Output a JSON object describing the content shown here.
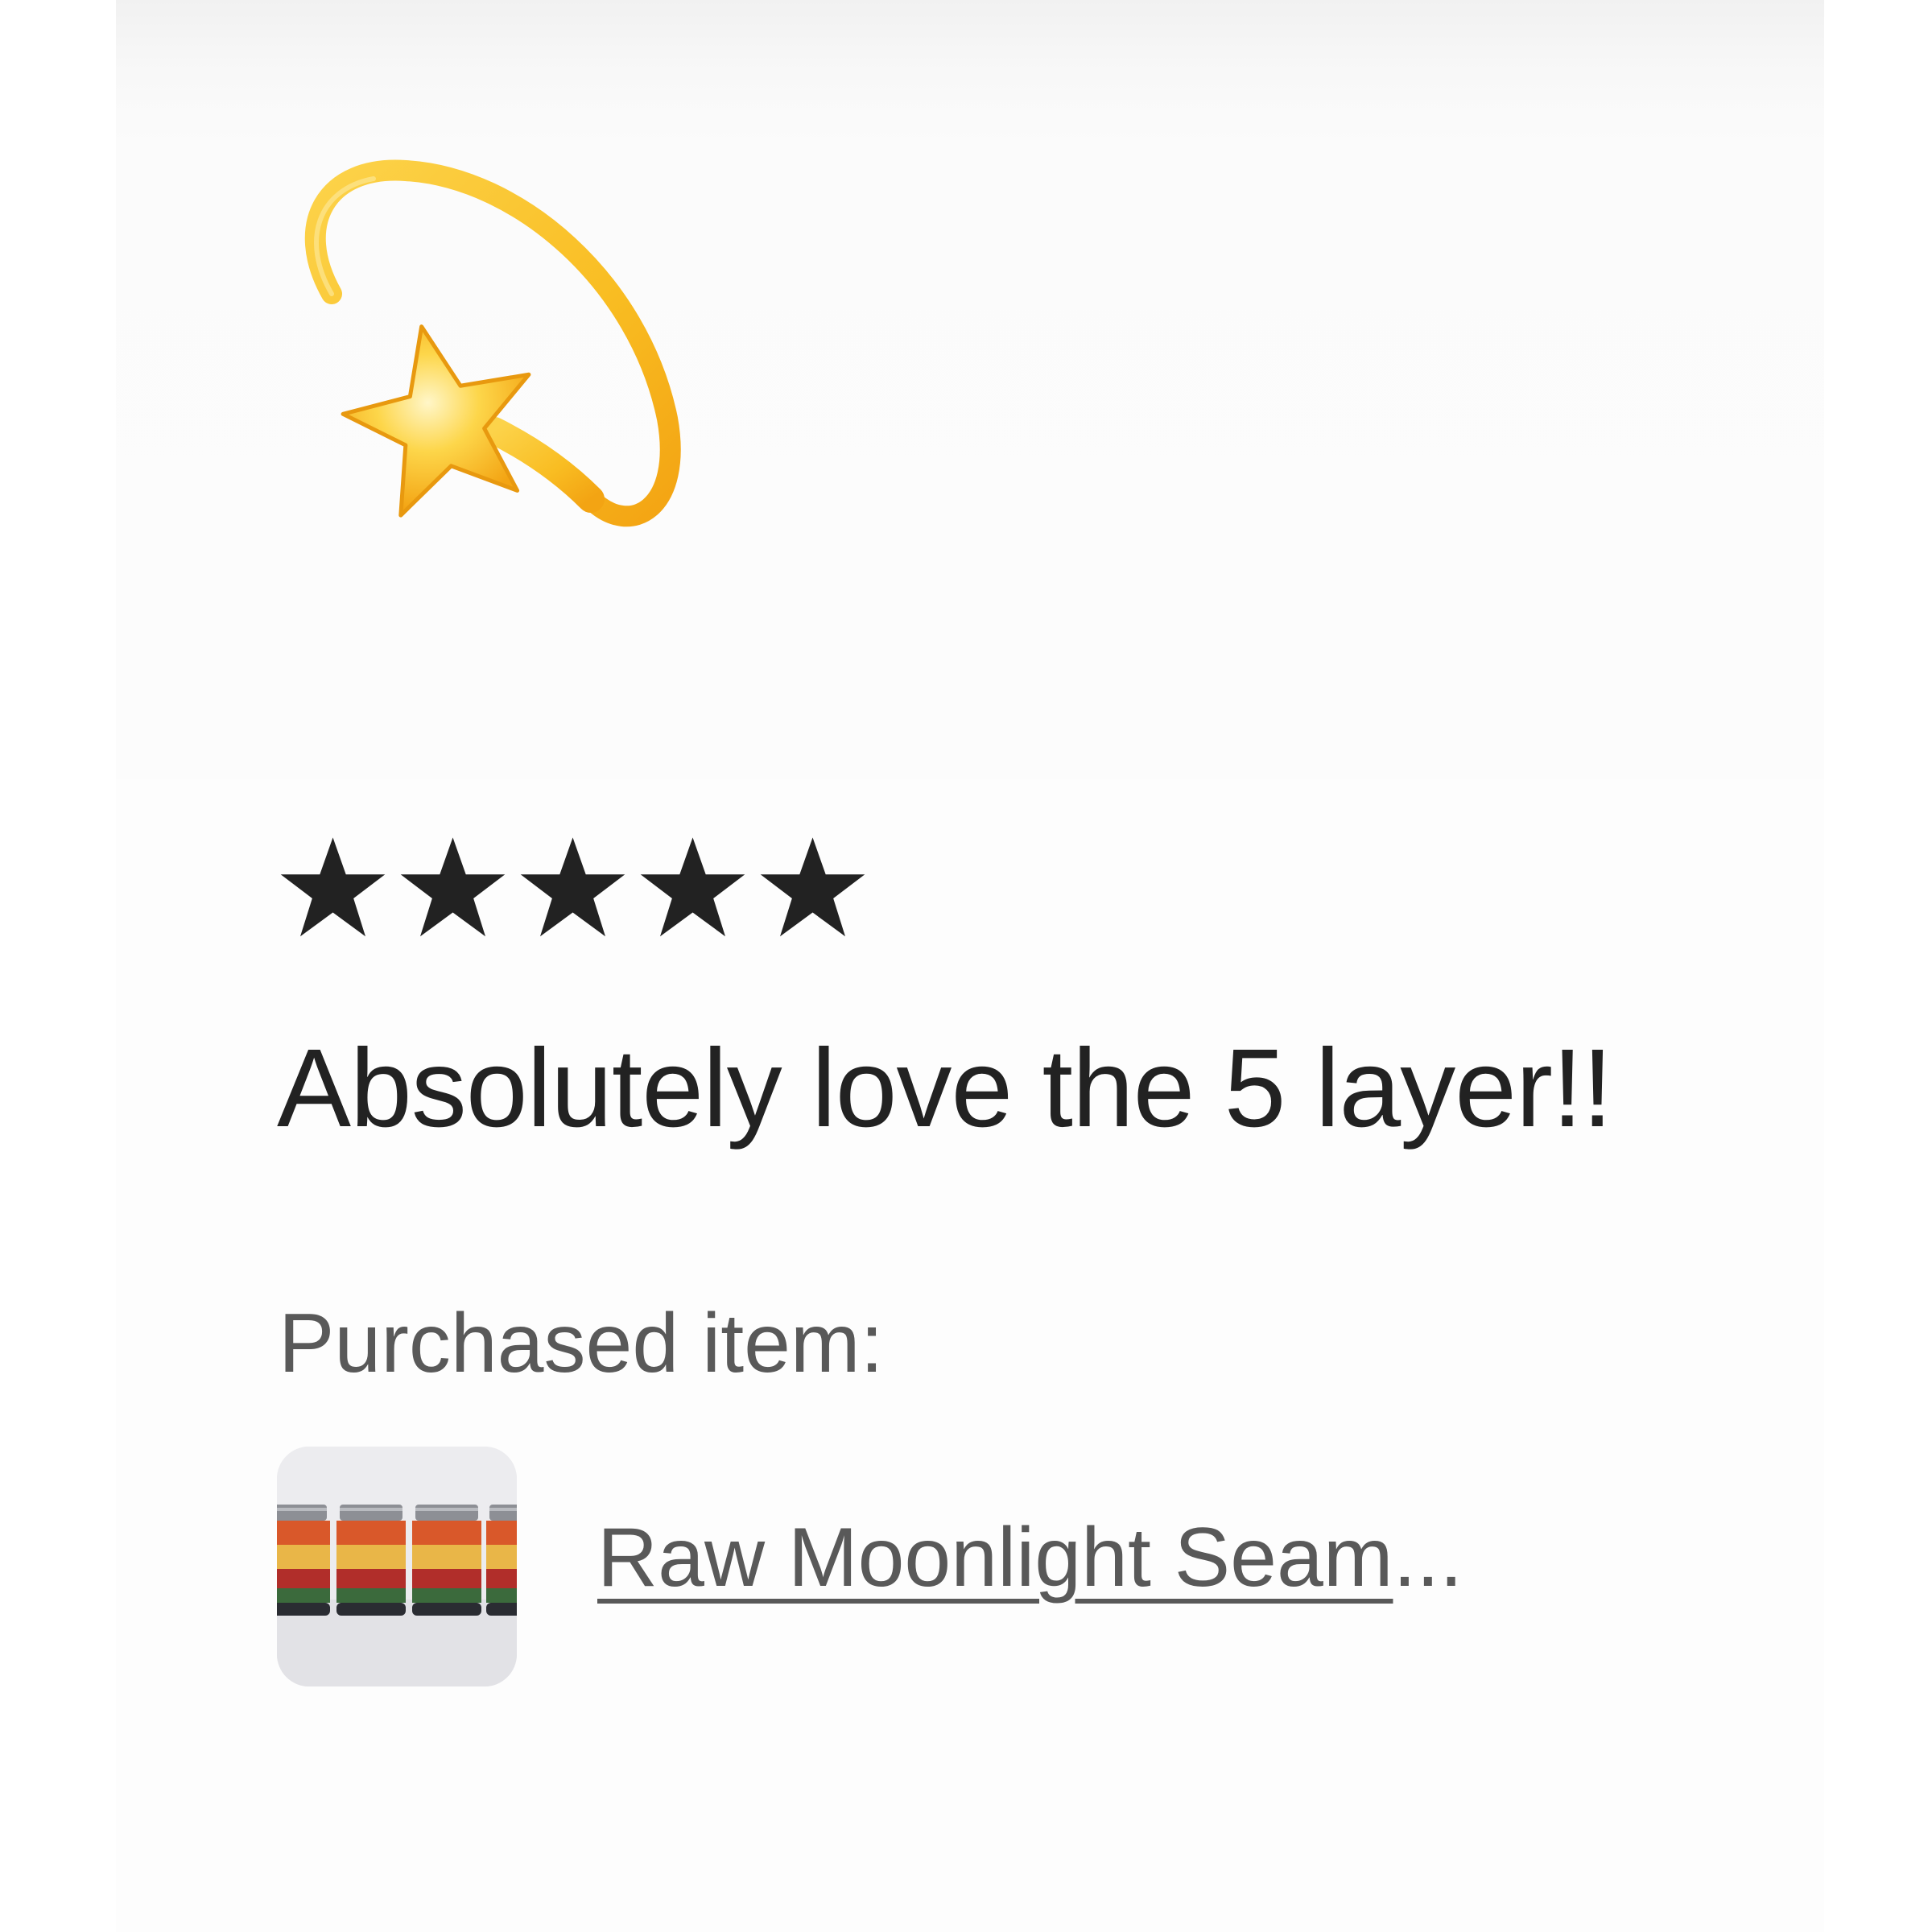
{
  "review": {
    "photo_icon": "dizzy-star-icon",
    "rating": 5,
    "rating_max": 5,
    "text": "Absolutely love the 5 layer!!"
  },
  "purchased": {
    "label": "Purchased item:",
    "item_title": "Raw Moonlight Seam",
    "item_title_ellipsis": "...",
    "thumbnail_icon": "layered-candle-jars-image"
  },
  "colors": {
    "star": "#222222",
    "text_primary": "#222222",
    "text_secondary": "#595959",
    "emoji_gold": "#f6b21b"
  }
}
